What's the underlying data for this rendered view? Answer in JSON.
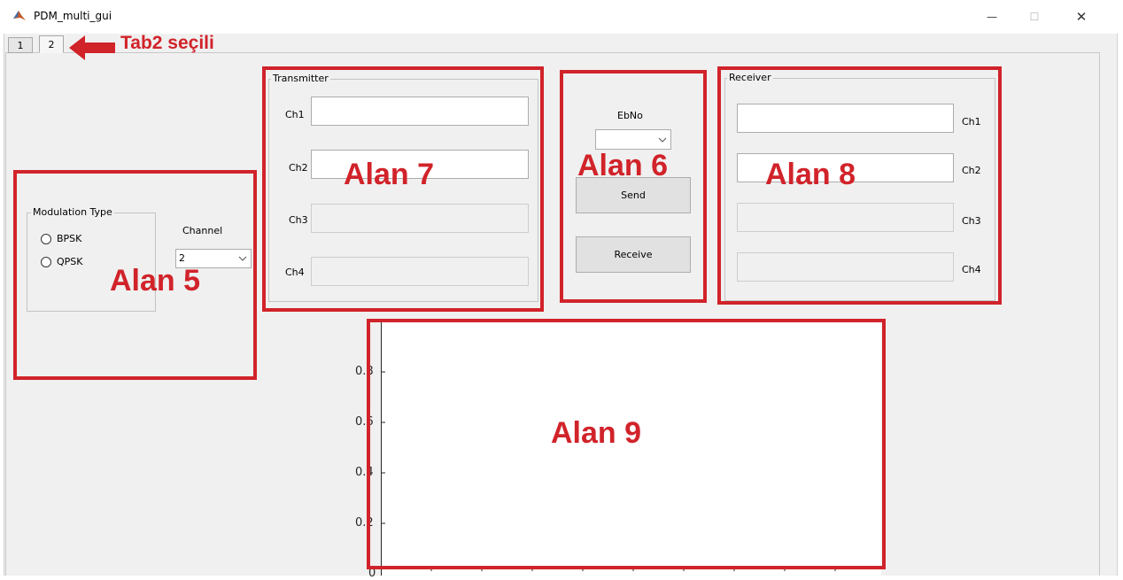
{
  "window": {
    "title": "PDM_multi_gui",
    "icon": "matlab-icon",
    "controls": {
      "minimize": "—",
      "maximize": "☐",
      "close": "✕"
    }
  },
  "tabs": [
    {
      "label": "1",
      "active": false
    },
    {
      "label": "2",
      "active": true
    }
  ],
  "modulation": {
    "group_title": "Modulation Type",
    "options": [
      {
        "label": "BPSK",
        "selected": false
      },
      {
        "label": "QPSK",
        "selected": false
      }
    ]
  },
  "channel": {
    "label": "Channel",
    "value": "2"
  },
  "transmitter": {
    "group_title": "Transmitter",
    "fields": [
      {
        "label": "Ch1",
        "value": "",
        "enabled": true
      },
      {
        "label": "Ch2",
        "value": "",
        "enabled": true
      },
      {
        "label": "Ch3",
        "value": "",
        "enabled": false
      },
      {
        "label": "Ch4",
        "value": "",
        "enabled": false
      }
    ]
  },
  "control": {
    "ebno_label": "EbNo",
    "ebno_value": "",
    "send_label": "Send",
    "receive_label": "Receive"
  },
  "receiver": {
    "group_title": "Receiver",
    "fields": [
      {
        "label": "Ch1",
        "value": "",
        "enabled": true
      },
      {
        "label": "Ch2",
        "value": "",
        "enabled": true
      },
      {
        "label": "Ch3",
        "value": "",
        "enabled": false
      },
      {
        "label": "Ch4",
        "value": "",
        "enabled": false
      }
    ]
  },
  "axes": {
    "ytick_labels": [
      "0.8",
      "0.6",
      "0.4",
      "0.2",
      "0"
    ]
  },
  "annotations": {
    "tab_note": "Tab2 seçili",
    "area5": "Alan 5",
    "area6": "Alan 6",
    "area7": "Alan 7",
    "area8": "Alan 8",
    "area9": "Alan 9",
    "color": "#d1232a"
  }
}
